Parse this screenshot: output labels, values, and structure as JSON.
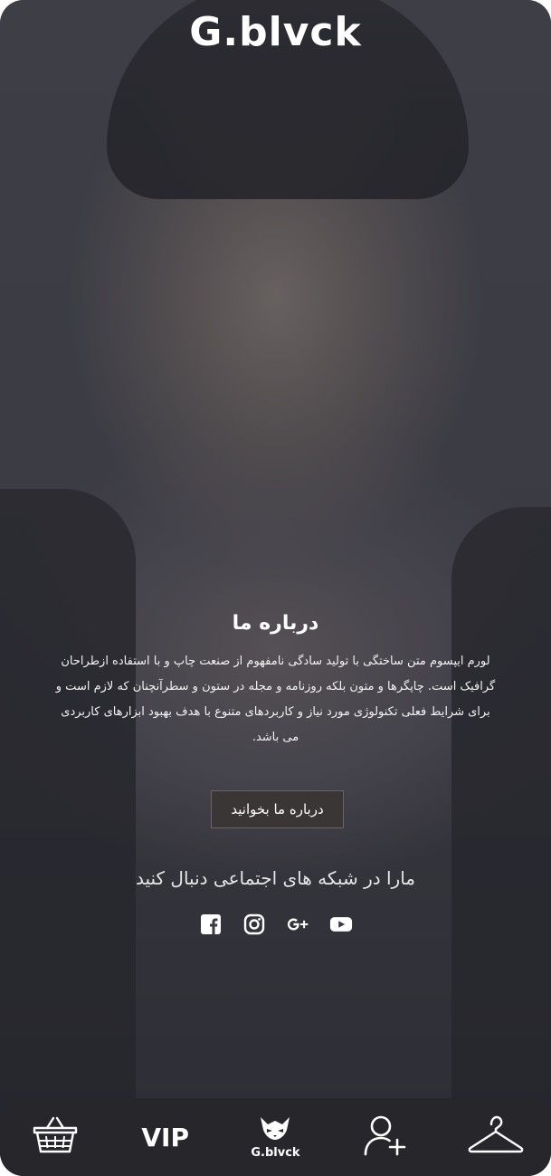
{
  "header": {
    "brand": "G.blvck"
  },
  "about": {
    "title": "درباره ما",
    "body": "لورم ایپسوم متن ساختگی با تولید سادگی نامفهوم از صنعت چاپ و با استفاده ازطراحان گرافیک است. چاپگرها و متون بلکه روزنامه و مجله در ستون و سطرآنچنان که لازم است و برای شرایط فعلی تکنولوژی مورد نیاز و کاربردهای متنوع با هدف بهبود ابزارهای کاربردی می باشد.",
    "button_label": "درباره ما بخوانید"
  },
  "social": {
    "heading": "مارا در شبکه های اجتماعی دنبال کنید",
    "icons": [
      "youtube-icon",
      "google-plus-icon",
      "instagram-icon",
      "facebook-icon"
    ]
  },
  "bottom_nav": {
    "items": [
      {
        "icon": "hanger-icon"
      },
      {
        "icon": "add-user-icon"
      },
      {
        "icon": "gblvck-logo",
        "label": "G.blvck"
      },
      {
        "label": "VIP"
      },
      {
        "icon": "basket-icon"
      }
    ]
  },
  "colors": {
    "nav_bg": "#26262b",
    "button_bg": "#3a3636",
    "text": "#ffffff"
  }
}
